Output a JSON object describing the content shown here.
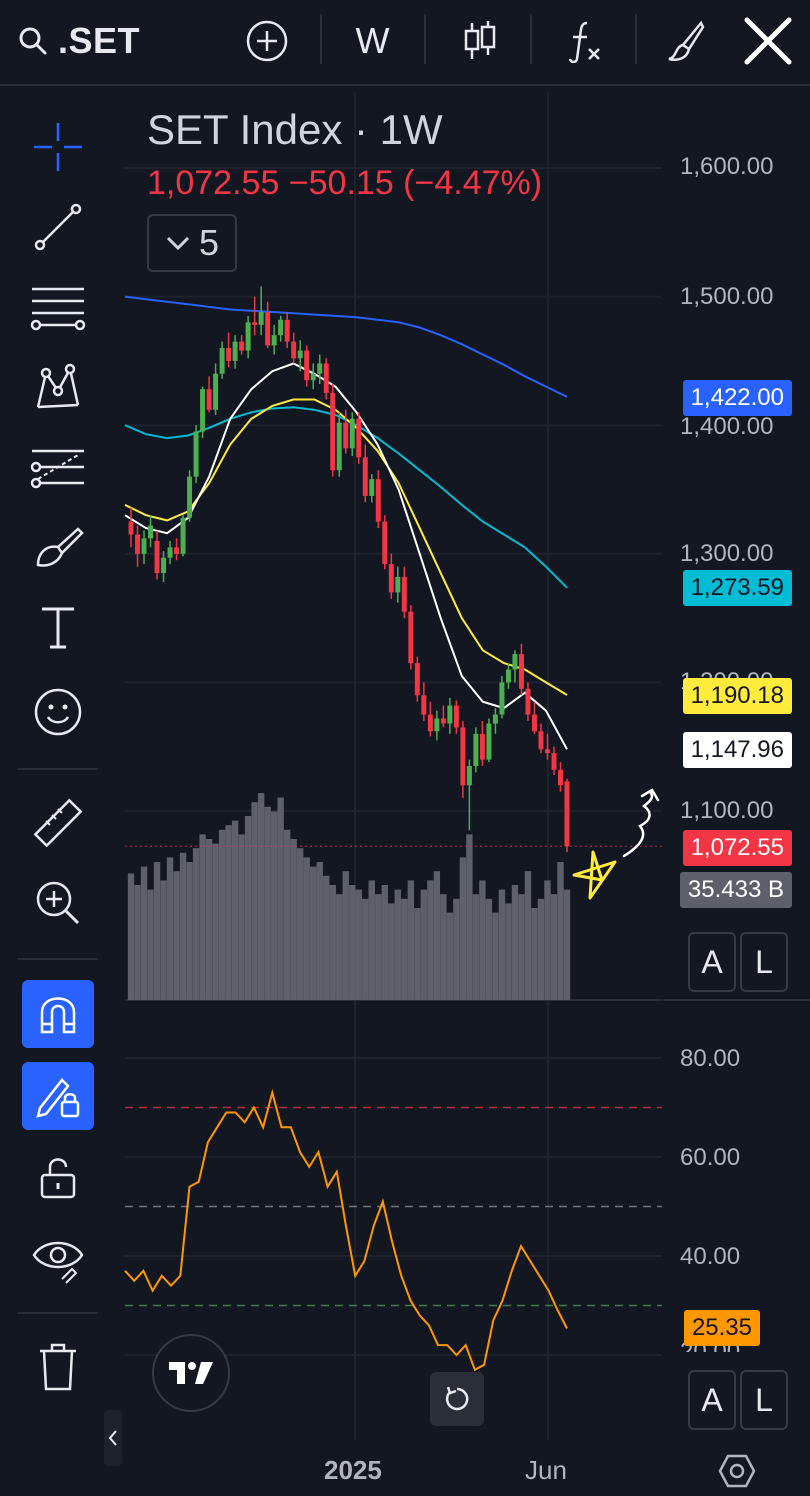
{
  "toolbar": {
    "symbol": ".SET",
    "interval": "W",
    "icons": [
      "search-icon",
      "add-compare-icon",
      "candles-icon",
      "indicators-icon",
      "drawing-brush-icon",
      "close-icon"
    ]
  },
  "sidebar": {
    "tools": [
      "crosshair-icon",
      "trend-line-icon",
      "fib-lines-icon",
      "pattern-icon",
      "projection-icon",
      "brush-icon",
      "text-icon",
      "emoji-icon",
      "ruler-icon",
      "zoom-in-icon",
      "magnet-icon",
      "lock-drawing-icon",
      "unlock-icon",
      "eye-icon",
      "trash-icon"
    ]
  },
  "legend": {
    "title": "SET Index · 1W",
    "price_line": "1,072.55 −50.15 (−4.47%)",
    "collapse_count": "5"
  },
  "price_axis": {
    "ticks": [
      "1,600.00",
      "1,500.00",
      "1,400.00",
      "1,300.00",
      "1,200.00",
      "1,100.00"
    ],
    "labels": {
      "ma_blue": "1,422.00",
      "ma_cyan": "1,273.59",
      "ma_yellow": "1,190.18",
      "ma_white": "1,147.96",
      "last_price": "1,072.55",
      "volume": "35.433 B"
    }
  },
  "rsi_axis": {
    "ticks": [
      "80.00",
      "60.00",
      "40.00",
      "20.00"
    ],
    "value": "25.35"
  },
  "time_axis": {
    "labels": [
      "2025",
      "Jun"
    ]
  },
  "buttons": {
    "auto": "A",
    "log": "L"
  },
  "colors": {
    "up": "#26a69a",
    "up_green": "#4caf50",
    "down": "#f23645",
    "ma_blue": "#2962ff",
    "ma_cyan": "#00bcd4",
    "ma_yellow": "#ffeb3b",
    "ma_white": "#ffffff",
    "rsi": "#ff9800",
    "accent": "#2962ff"
  },
  "chart_data": {
    "type": "candlestick",
    "title": "SET Index · 1W",
    "ylim": [
      1020,
      1660
    ],
    "last": 1072.55,
    "change": -50.15,
    "change_pct": -4.47,
    "candles": [
      [
        1325,
        1336,
        1305,
        1315
      ],
      [
        1315,
        1322,
        1290,
        1300
      ],
      [
        1300,
        1318,
        1292,
        1312
      ],
      [
        1312,
        1330,
        1305,
        1322
      ],
      [
        1310,
        1318,
        1280,
        1285
      ],
      [
        1285,
        1302,
        1278,
        1297
      ],
      [
        1297,
        1310,
        1292,
        1305
      ],
      [
        1305,
        1312,
        1295,
        1300
      ],
      [
        1300,
        1330,
        1298,
        1328
      ],
      [
        1328,
        1365,
        1325,
        1360
      ],
      [
        1360,
        1400,
        1355,
        1395
      ],
      [
        1395,
        1430,
        1390,
        1428
      ],
      [
        1428,
        1438,
        1410,
        1412
      ],
      [
        1412,
        1448,
        1408,
        1440
      ],
      [
        1440,
        1465,
        1436,
        1460
      ],
      [
        1460,
        1472,
        1445,
        1450
      ],
      [
        1450,
        1470,
        1444,
        1465
      ],
      [
        1465,
        1470,
        1455,
        1458
      ],
      [
        1458,
        1485,
        1452,
        1480
      ],
      [
        1480,
        1500,
        1470,
        1478
      ],
      [
        1478,
        1508,
        1470,
        1488
      ],
      [
        1488,
        1496,
        1460,
        1462
      ],
      [
        1462,
        1478,
        1455,
        1470
      ],
      [
        1470,
        1485,
        1465,
        1482
      ],
      [
        1482,
        1488,
        1460,
        1465
      ],
      [
        1465,
        1472,
        1448,
        1452
      ],
      [
        1452,
        1466,
        1442,
        1458
      ],
      [
        1458,
        1462,
        1430,
        1435
      ],
      [
        1435,
        1448,
        1428,
        1440
      ],
      [
        1440,
        1455,
        1432,
        1448
      ],
      [
        1448,
        1452,
        1420,
        1425
      ],
      [
        1425,
        1432,
        1360,
        1365
      ],
      [
        1365,
        1410,
        1360,
        1402
      ],
      [
        1402,
        1412,
        1378,
        1382
      ],
      [
        1382,
        1410,
        1376,
        1405
      ],
      [
        1405,
        1410,
        1370,
        1375
      ],
      [
        1375,
        1385,
        1340,
        1345
      ],
      [
        1345,
        1362,
        1340,
        1358
      ],
      [
        1358,
        1365,
        1320,
        1325
      ],
      [
        1325,
        1330,
        1288,
        1292
      ],
      [
        1292,
        1300,
        1265,
        1270
      ],
      [
        1270,
        1290,
        1262,
        1282
      ],
      [
        1282,
        1290,
        1250,
        1255
      ],
      [
        1255,
        1260,
        1210,
        1215
      ],
      [
        1215,
        1220,
        1185,
        1190
      ],
      [
        1190,
        1200,
        1170,
        1175
      ],
      [
        1175,
        1185,
        1158,
        1162
      ],
      [
        1162,
        1178,
        1155,
        1172
      ],
      [
        1172,
        1182,
        1165,
        1168
      ],
      [
        1168,
        1188,
        1160,
        1182
      ],
      [
        1182,
        1186,
        1160,
        1165
      ],
      [
        1165,
        1170,
        1110,
        1120
      ],
      [
        1120,
        1140,
        1085,
        1135
      ],
      [
        1135,
        1165,
        1130,
        1160
      ],
      [
        1160,
        1170,
        1135,
        1140
      ],
      [
        1140,
        1172,
        1138,
        1168
      ],
      [
        1168,
        1180,
        1160,
        1175
      ],
      [
        1175,
        1205,
        1172,
        1200
      ],
      [
        1200,
        1215,
        1195,
        1210
      ],
      [
        1210,
        1225,
        1200,
        1222
      ],
      [
        1222,
        1230,
        1190,
        1195
      ],
      [
        1195,
        1200,
        1170,
        1175
      ],
      [
        1175,
        1185,
        1160,
        1162
      ],
      [
        1162,
        1168,
        1145,
        1148
      ],
      [
        1148,
        1160,
        1140,
        1145
      ],
      [
        1145,
        1150,
        1128,
        1132
      ],
      [
        1132,
        1138,
        1115,
        1120
      ],
      [
        1123,
        1125,
        1068,
        1072.55
      ]
    ],
    "ma_blue": [
      1500,
      1498,
      1496,
      1494,
      1492,
      1490,
      1489,
      1488,
      1487,
      1486,
      1485,
      1484,
      1482,
      1480,
      1476,
      1470,
      1463,
      1455,
      1447,
      1438,
      1430,
      1422
    ],
    "ma_cyan": [
      1400,
      1393,
      1390,
      1392,
      1398,
      1405,
      1410,
      1413,
      1414,
      1412,
      1408,
      1400,
      1390,
      1378,
      1365,
      1352,
      1338,
      1325,
      1315,
      1305,
      1290,
      1273.59
    ],
    "ma_yellow": [
      1338,
      1330,
      1326,
      1333,
      1355,
      1385,
      1405,
      1415,
      1420,
      1420,
      1412,
      1398,
      1380,
      1355,
      1320,
      1285,
      1250,
      1225,
      1215,
      1210,
      1200,
      1190.18
    ],
    "ma_white": [
      1330,
      1320,
      1316,
      1328,
      1360,
      1405,
      1428,
      1442,
      1448,
      1440,
      1430,
      1410,
      1385,
      1350,
      1300,
      1250,
      1205,
      1185,
      1180,
      1192,
      1178,
      1147.96
    ],
    "volume": [
      55,
      50,
      58,
      48,
      60,
      52,
      62,
      56,
      64,
      60,
      66,
      72,
      70,
      68,
      74,
      76,
      78,
      72,
      80,
      86,
      90,
      84,
      82,
      88,
      74,
      70,
      66,
      62,
      58,
      60,
      54,
      50,
      46,
      56,
      50,
      48,
      44,
      52,
      46,
      50,
      42,
      48,
      44,
      52,
      40,
      48,
      52,
      56,
      46,
      38,
      44,
      62,
      72,
      46,
      52,
      44,
      38,
      48,
      42,
      50,
      46,
      56,
      40,
      44,
      52,
      46,
      60,
      48
    ],
    "rsi": [
      37,
      35,
      37,
      33,
      36,
      34,
      36,
      54,
      55,
      63,
      66,
      69,
      69,
      67,
      70,
      66,
      73,
      66,
      66,
      61,
      58,
      61,
      54,
      57,
      46,
      36,
      39,
      46,
      51,
      43,
      36,
      31,
      28,
      26,
      22,
      22,
      20,
      22,
      17,
      18,
      27,
      31,
      37,
      42,
      39,
      36,
      33,
      29,
      25.35
    ]
  }
}
